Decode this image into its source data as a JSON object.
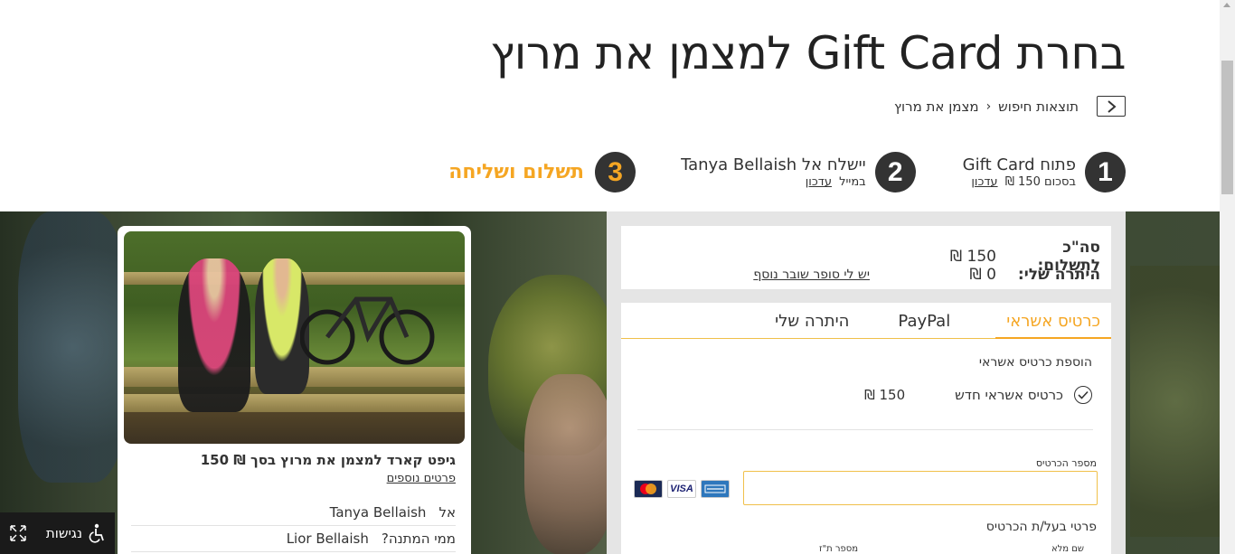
{
  "page": {
    "title": "בחרת Gift Card למצמן את מרוץ"
  },
  "breadcrumb": {
    "items": [
      "תוצאות חיפוש",
      "מצמן את מרוץ"
    ]
  },
  "steps": [
    {
      "number": "1",
      "title": "פתוח Gift Card",
      "sub_prefix": "בסכום 150 ₪",
      "sub_link": "עדכון"
    },
    {
      "number": "2",
      "title": "יישלח אל Tanya Bellaish",
      "sub_prefix": "במייל",
      "sub_link": "עדכון"
    },
    {
      "number": "3",
      "title": "תשלום ושליחה"
    }
  ],
  "totals": {
    "total_label": "סה\"כ לתשלום:",
    "total_value": "150 ₪",
    "balance_label": "היתרה שלי:",
    "balance_value": "0 ₪",
    "super_voucher_link": "יש לי סופר שובר נוסף"
  },
  "payment": {
    "tabs": [
      "כרטיס אשראי",
      "PayPal",
      "היתרה שלי"
    ],
    "active_tab": "כרטיס אשראי",
    "add_card_label": "הוספת כרטיס אשראי",
    "new_card_label": "כרטיס אשראי חדש",
    "new_card_amount": "150 ₪",
    "card_number_label": "מספר הכרטיס",
    "card_number_value": "",
    "holder_details_title": "פרטי בעל/ת הכרטיס",
    "full_name_label": "שם מלא",
    "id_label": "מספר ת\"ז",
    "card_logos": [
      "mastercard",
      "VISA",
      "AMERICAN EXPRESS"
    ]
  },
  "gift_card": {
    "title": "גיפט קארד למצמן את מרוץ בסך ₪ 150",
    "more_details": "פרטים נוספים",
    "to_label": "אל",
    "to_value": "Tanya Bellaish",
    "from_label": "ממי המתנה?",
    "from_value": "Lior Bellaish"
  },
  "accessibility": {
    "label": "נגישות"
  },
  "colors": {
    "accent": "#f5a623",
    "step_circle": "#333333",
    "panel_bg": "#e5e5e5"
  }
}
